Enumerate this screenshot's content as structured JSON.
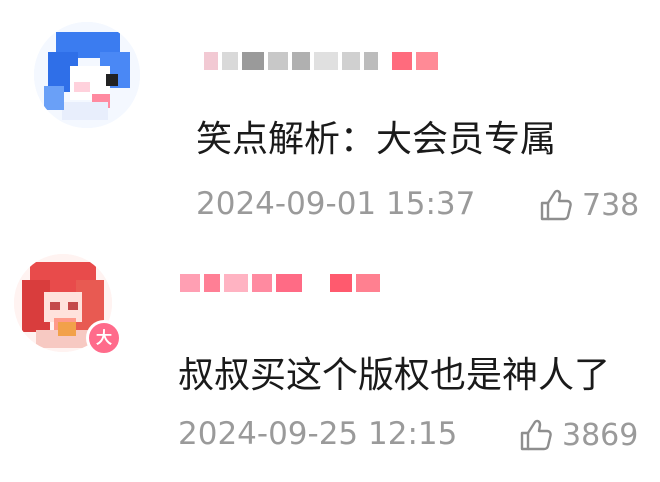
{
  "comments": [
    {
      "id": "c1",
      "avatar_icon": "blue-anime-avatar",
      "username_color": "#ff4d6d",
      "text": "笑点解析：大会员专属",
      "time": "2024-09-01 15:37",
      "like_icon": "thumb-up-icon",
      "likes": "738"
    },
    {
      "id": "c2",
      "avatar_icon": "red-hair-anime-avatar",
      "badge_text": "大",
      "badge_color": "#ff6b8b",
      "username_color": "#ff4d6d",
      "text": "叔叔买这个版权也是神人了",
      "time": "2024-09-25 12:15",
      "like_icon": "thumb-up-icon",
      "likes": "3869"
    }
  ]
}
